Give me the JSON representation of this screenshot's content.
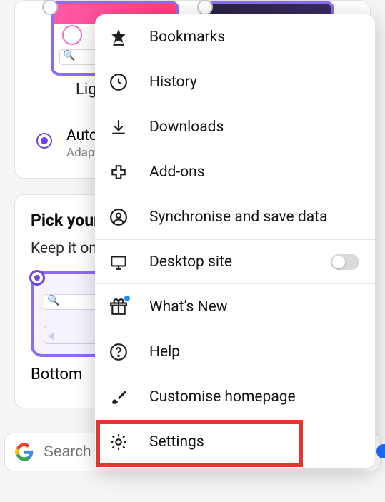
{
  "background": {
    "light_label": "Light",
    "auto": {
      "title": "Automatic",
      "subtitle": "Adapts to your device settings"
    },
    "pick": {
      "title": "Pick your toolbar placement",
      "subtitle": "Keep it on the bottom or move it up",
      "first_option": "Bottom"
    },
    "search_placeholder": "Search or enter address"
  },
  "menu": {
    "bookmarks": "Bookmarks",
    "history": "History",
    "downloads": "Downloads",
    "addons": "Add-ons",
    "sync": "Synchronise and save data",
    "desktop_site": "Desktop site",
    "whats_new": "What’s New",
    "help": "Help",
    "customise": "Customise homepage",
    "settings": "Settings"
  },
  "toggles": {
    "desktop_site_on": false
  }
}
